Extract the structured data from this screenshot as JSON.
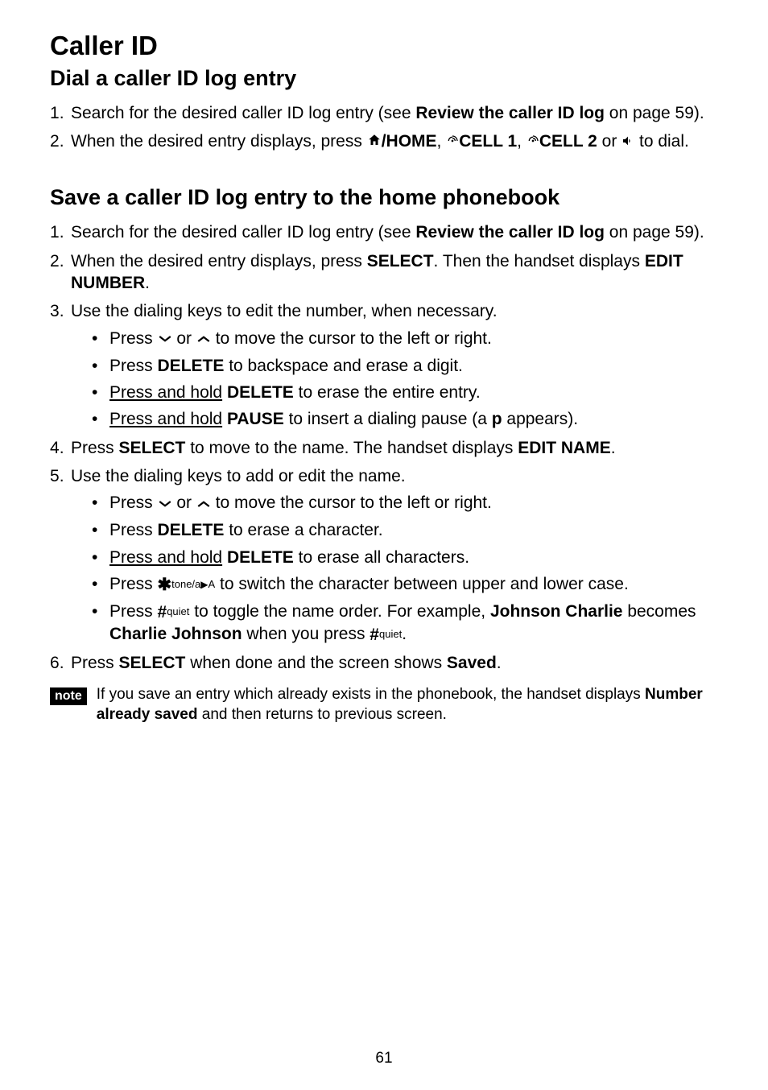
{
  "pageNumber": "61",
  "heading": "Caller ID",
  "section1": {
    "title": "Dial a caller ID log entry",
    "item1_pre": "Search for the desired caller ID log entry (see ",
    "item1_bold": "Review the caller ID log",
    "item1_post": " on page 59).",
    "item2_pre": "When the desired entry displays, press ",
    "item2_b1": "/HOME",
    "item2_sep1": ", ",
    "item2_b2": "CELL 1",
    "item2_sep2": ", ",
    "item2_b3": "CELL 2",
    "item2_sep3": " or ",
    "item2_post": " to dial."
  },
  "section2": {
    "title": "Save a caller ID log entry to the home phonebook",
    "item1_pre": "Search for the desired caller ID log entry (see ",
    "item1_bold": "Review the caller ID log",
    "item1_post": " on page 59).",
    "item2_pre": "When the desired entry displays, press ",
    "item2_b1": "SELECT",
    "item2_mid": ". Then the handset displays ",
    "item2_b2": "EDIT NUMBER",
    "item2_post": ".",
    "item3": "Use the dialing keys to edit the number, when necessary.",
    "item3_sub1_pre": "Press ",
    "item3_sub1_mid": " or ",
    "item3_sub1_post": " to move the cursor to the left or right.",
    "item3_sub2_pre": "Press ",
    "item3_sub2_b": "DELETE",
    "item3_sub2_post": " to backspace and erase a digit.",
    "item3_sub3_u": "Press and hold",
    "item3_sub3_sp": " ",
    "item3_sub3_b": "DELETE",
    "item3_sub3_post": " to erase the entire entry.",
    "item3_sub4_u": "Press and hold",
    "item3_sub4_sp": " ",
    "item3_sub4_b": "PAUSE",
    "item3_sub4_mid": " to insert a dialing pause (a ",
    "item3_sub4_b2": "p",
    "item3_sub4_post": " appears).",
    "item4_pre": "Press ",
    "item4_b1": "SELECT",
    "item4_mid": " to move to the name. The handset displays ",
    "item4_b2": "EDIT NAME",
    "item4_post": ".",
    "item5": "Use the dialing keys to add or edit the name.",
    "item5_sub1_pre": "Press ",
    "item5_sub1_mid": " or ",
    "item5_sub1_post": " to move the cursor to the left or right.",
    "item5_sub2_pre": "Press ",
    "item5_sub2_b": "DELETE",
    "item5_sub2_post": " to erase a character.",
    "item5_sub3_u": "Press and hold",
    "item5_sub3_sp": " ",
    "item5_sub3_b": "DELETE",
    "item5_sub3_post": " to erase all characters.",
    "item5_sub4_pre": "Press ",
    "item5_sub4_post": " to switch the character between upper and lower case.",
    "item5_sub5_pre": "Press ",
    "item5_sub5_mid": " to toggle the name order. For example, ",
    "item5_sub5_b1": "Johnson Charlie",
    "item5_sub5_mid2": " becomes ",
    "item5_sub5_b2": "Charlie Johnson",
    "item5_sub5_mid3": " when you press ",
    "item5_sub5_post": ".",
    "item6_pre": "Press ",
    "item6_b1": "SELECT",
    "item6_mid": " when done and the screen shows ",
    "item6_b2": "Saved",
    "item6_post": "."
  },
  "note": {
    "badge": "note",
    "text_pre": "If you save an entry which already exists in the phonebook, the handset displays ",
    "text_b": "Number already saved",
    "text_post": " and then returns to previous screen."
  },
  "keyLabels": {
    "tone": "tone/a",
    "toneA": "A",
    "quiet": "quiet"
  }
}
